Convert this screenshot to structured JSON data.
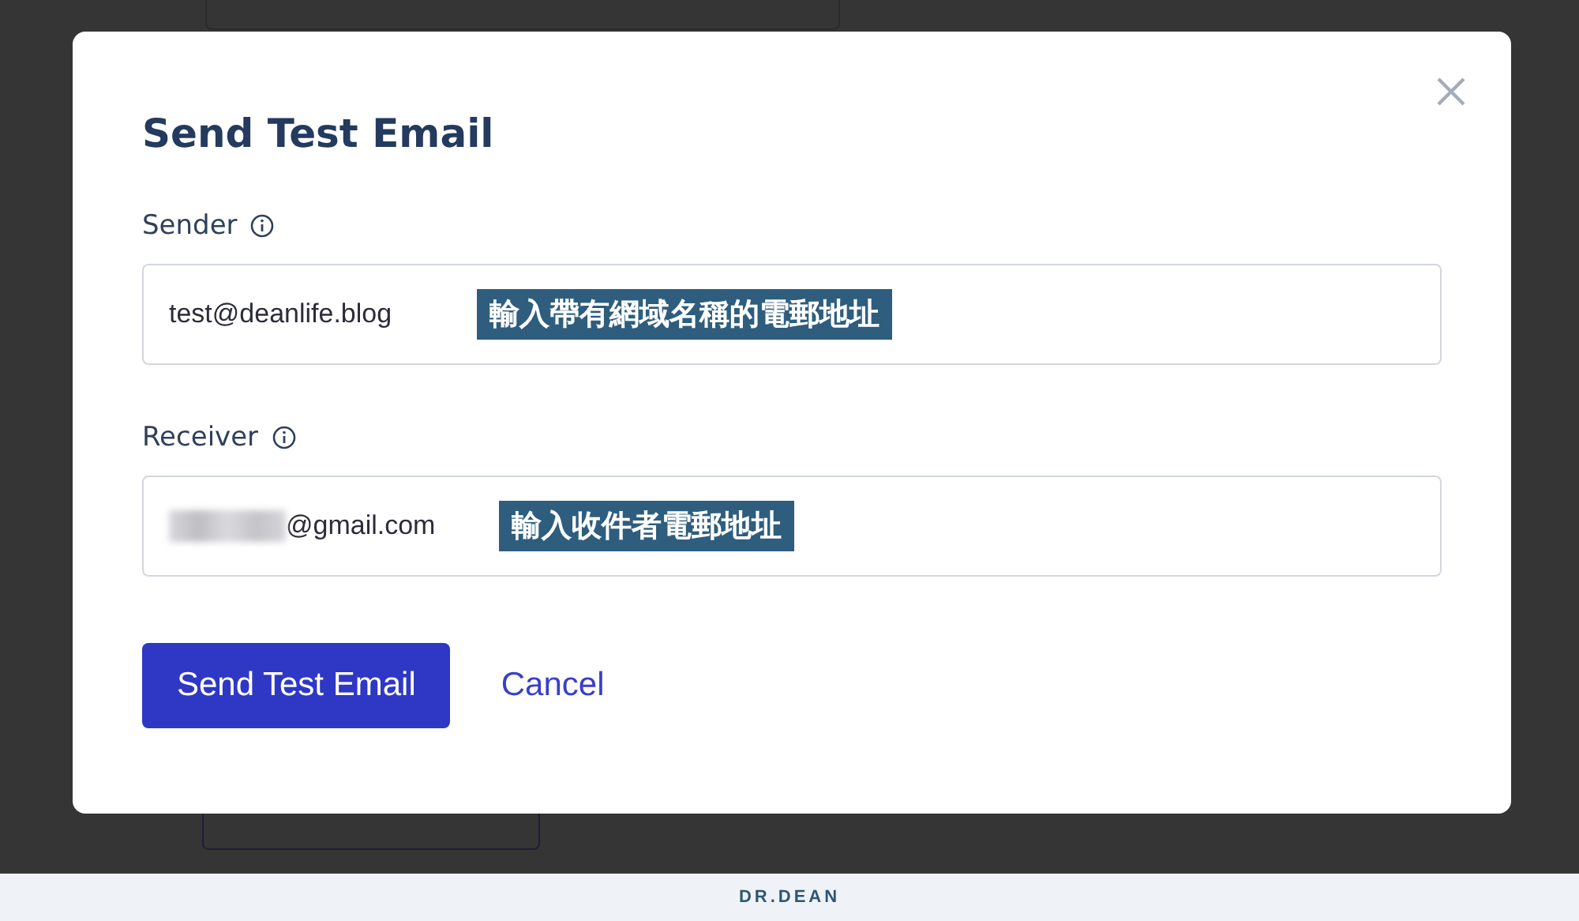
{
  "dialog": {
    "title": "Send Test Email",
    "fields": [
      {
        "label": "Sender",
        "value": "test@deanlife.blog",
        "redacted": false,
        "annotation": "輸入帶有網域名稱的電郵地址"
      },
      {
        "label": "Receiver",
        "value": "@gmail.com",
        "redacted": true,
        "annotation": "輸入收件者電郵地址"
      }
    ],
    "buttons": [
      {
        "label": "Send Test Email",
        "kind": "primary"
      },
      {
        "label": "Cancel",
        "kind": "link"
      }
    ]
  },
  "footer": {
    "logo": "DR.DEAN"
  }
}
